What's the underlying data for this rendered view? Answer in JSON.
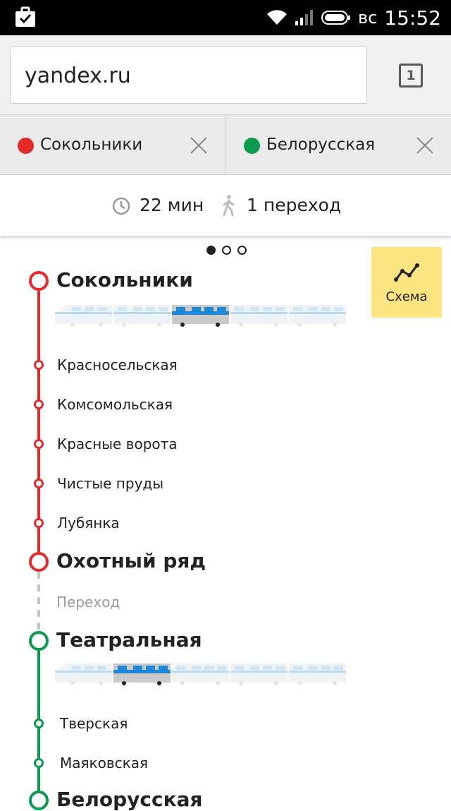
{
  "status_bar": {
    "day": "вс",
    "time": "15:52",
    "icons": [
      "briefcase-check-icon",
      "wifi-icon",
      "signal-icon",
      "battery-icon"
    ]
  },
  "browser": {
    "url": "yandex.ru",
    "tab_count": "1"
  },
  "route_header": {
    "from": {
      "name": "Сокольники",
      "color": "#e32b2b"
    },
    "to": {
      "name": "Белорусская",
      "color": "#0b9a4e"
    },
    "duration": "22 мин",
    "transfers": "1 переход"
  },
  "pager": {
    "pages": 3,
    "active": 0
  },
  "scheme_button": {
    "label": "Схема",
    "color": "#fbe481"
  },
  "route": {
    "segments": [
      {
        "line_color": "#e32b2b",
        "start": "Сокольники",
        "recommended_car": 3,
        "cars": 5,
        "intermediate": [
          "Красносельская",
          "Комсомольская",
          "Красные ворота",
          "Чистые пруды",
          "Лубянка"
        ],
        "end": "Охотный ряд"
      },
      {
        "line_color": "#0b9a4e",
        "start": "Театральная",
        "recommended_car": 2,
        "cars": 5,
        "intermediate": [
          "Тверская",
          "Маяковская"
        ],
        "end": "Белорусская"
      }
    ],
    "transfer_label": "Переход"
  }
}
